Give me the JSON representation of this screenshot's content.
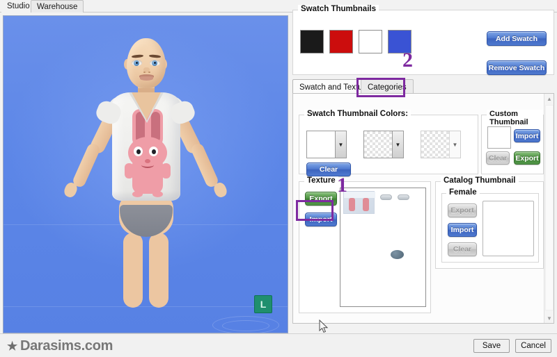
{
  "window": {
    "tabs": [
      {
        "label": "Studio",
        "active": true
      },
      {
        "label": "Warehouse",
        "active": false
      }
    ]
  },
  "viewport": {
    "gizmo_label": "L",
    "background_color": "#5d87e8"
  },
  "swatch_thumbnails": {
    "legend": "Swatch Thumbnails",
    "swatches": [
      {
        "name": "black",
        "color": "#1a1a1a"
      },
      {
        "name": "red",
        "color": "#cc0d0d"
      },
      {
        "name": "white",
        "color": "#ffffff"
      },
      {
        "name": "blue",
        "color": "#3a53d4"
      }
    ],
    "add_label": "Add Swatch",
    "remove_label": "Remove Swatch"
  },
  "markers": [
    {
      "label": "1",
      "color": "#7e2aa0",
      "target": "texture-import-button"
    },
    {
      "label": "2",
      "color": "#7e2aa0",
      "target": "categories-tab"
    }
  ],
  "tab_control": {
    "tabs": [
      {
        "label": "Swatch and Texture",
        "active": true
      },
      {
        "label": "Categories",
        "active": false
      }
    ]
  },
  "swatch_colors": {
    "legend": "Swatch Thumbnail Colors:",
    "dropdowns": [
      {
        "name": "color-1",
        "fill": "solid-white",
        "enabled": true
      },
      {
        "name": "color-2",
        "fill": "transparent",
        "enabled": true
      },
      {
        "name": "color-3",
        "fill": "transparent",
        "enabled": false
      }
    ],
    "clear_label": "Clear",
    "arrow_glyph": "▼"
  },
  "custom_thumbnail": {
    "legend": "Custom Thumbnail",
    "import_label": "Import",
    "clear_label": "Clear",
    "export_label": "Export"
  },
  "texture": {
    "legend": "Texture",
    "export_label": "Export",
    "import_label": "Import"
  },
  "catalog_thumbnail": {
    "legend": "Catalog Thumbnail",
    "female_legend": "Female",
    "export_label": "Export",
    "import_label": "Import",
    "clear_label": "Clear"
  },
  "scrollbar": {
    "up_glyph": "▲",
    "down_glyph": "▼"
  },
  "footer": {
    "brand": "Darasims.com",
    "brand_icon": "★",
    "save_label": "Save",
    "cancel_label": "Cancel"
  }
}
